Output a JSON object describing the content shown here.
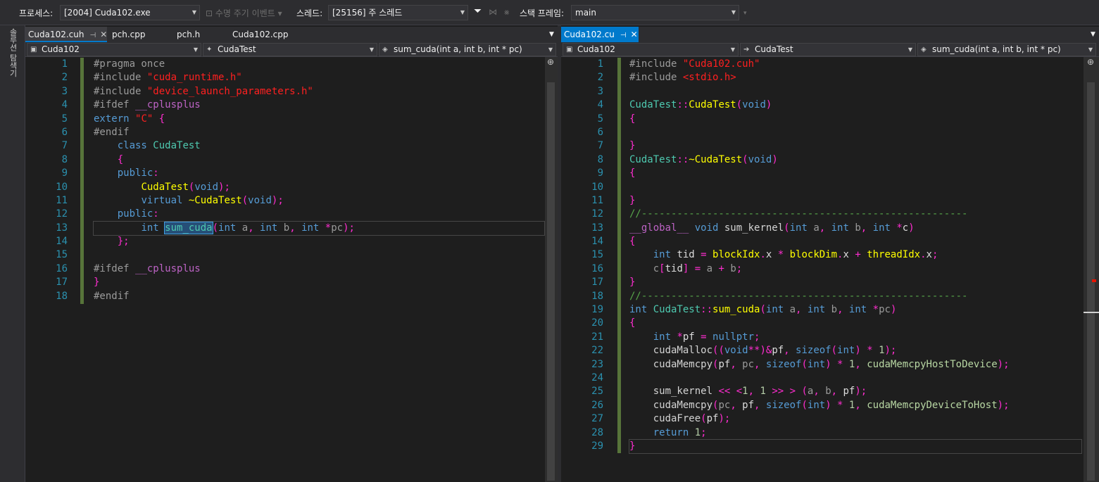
{
  "toolbar": {
    "process_label": "프로세스:",
    "process_value": "[2004] Cuda102.exe",
    "lifecycle_label": "수명 주기 이벤트",
    "thread_label": "스레드:",
    "thread_value": "[25156] 주 스레드",
    "stack_label": "스택 프레임:",
    "stack_value": "main"
  },
  "side_label": "솔루션 탐색기",
  "left": {
    "tabs": [
      {
        "label": "Cuda102.cuh",
        "active": true
      },
      {
        "label": "pch.cpp"
      },
      {
        "label": "pch.h"
      },
      {
        "label": "Cuda102.cpp"
      }
    ],
    "nav": {
      "project": "Cuda102",
      "class": "CudaTest",
      "member": "sum_cuda(int a, int b, int * pc)"
    },
    "line_numbers": [
      "1",
      "2",
      "3",
      "4",
      "5",
      "6",
      "7",
      "8",
      "9",
      "10",
      "11",
      "12",
      "13",
      "14",
      "15",
      "16",
      "17",
      "18"
    ]
  },
  "right": {
    "tabs": [
      {
        "label": "Cuda102.cu",
        "active": true
      }
    ],
    "nav": {
      "project": "Cuda102",
      "class": "CudaTest",
      "member": "sum_cuda(int a, int b, int * pc)"
    },
    "line_numbers": [
      "1",
      "2",
      "3",
      "4",
      "5",
      "6",
      "7",
      "8",
      "9",
      "10",
      "11",
      "12",
      "13",
      "14",
      "15",
      "16",
      "17",
      "18",
      "19",
      "20",
      "21",
      "22",
      "23",
      "24",
      "25",
      "26",
      "27",
      "28",
      "29"
    ]
  },
  "left_code": [
    [
      [
        "pp",
        "#pragma once"
      ]
    ],
    [
      [
        "pp",
        "#include "
      ],
      [
        "str",
        "\"cuda_runtime.h\""
      ]
    ],
    [
      [
        "pp",
        "#include "
      ],
      [
        "str",
        "\"device_launch_parameters.h\""
      ]
    ],
    [
      [
        "pp",
        "#ifdef "
      ],
      [
        "mac",
        "__cplusplus"
      ]
    ],
    [
      [
        "kw",
        "extern "
      ],
      [
        "str",
        "\"C\" "
      ],
      [
        "punc",
        "{"
      ]
    ],
    [
      [
        "pp",
        "#endif"
      ]
    ],
    [
      [
        "var",
        "    "
      ],
      [
        "kw",
        "class "
      ],
      [
        "cls",
        "CudaTest"
      ]
    ],
    [
      [
        "var",
        "    "
      ],
      [
        "punc",
        "{"
      ]
    ],
    [
      [
        "var",
        "    "
      ],
      [
        "kw",
        "public"
      ],
      [
        "punc",
        ":"
      ]
    ],
    [
      [
        "var",
        "        "
      ],
      [
        "glob",
        "CudaTest"
      ],
      [
        "punc",
        "("
      ],
      [
        "kw",
        "void"
      ],
      [
        "punc",
        ");"
      ]
    ],
    [
      [
        "var",
        "        "
      ],
      [
        "kw",
        "virtual "
      ],
      [
        "glob",
        "~CudaTest"
      ],
      [
        "punc",
        "("
      ],
      [
        "kw",
        "void"
      ],
      [
        "punc",
        ");"
      ]
    ],
    [
      [
        "var",
        "    "
      ],
      [
        "kw",
        "public"
      ],
      [
        "punc",
        ":"
      ]
    ],
    [
      [
        "var",
        "        "
      ],
      [
        "kw",
        "int "
      ],
      [
        "hlfn",
        "sum_cuda"
      ],
      [
        "punc",
        "("
      ],
      [
        "kw",
        "int "
      ],
      [
        "param",
        "a"
      ],
      [
        "punc",
        ", "
      ],
      [
        "kw",
        "int "
      ],
      [
        "param",
        "b"
      ],
      [
        "punc",
        ", "
      ],
      [
        "kw",
        "int "
      ],
      [
        "punc",
        "*"
      ],
      [
        "param",
        "pc"
      ],
      [
        "punc",
        ");"
      ]
    ],
    [
      [
        "var",
        "    "
      ],
      [
        "punc",
        "};"
      ]
    ],
    [
      [
        "var",
        ""
      ]
    ],
    [
      [
        "pp",
        "#ifdef "
      ],
      [
        "mac",
        "__cplusplus"
      ]
    ],
    [
      [
        "punc",
        "}"
      ]
    ],
    [
      [
        "pp",
        "#endif"
      ]
    ]
  ],
  "right_code": [
    [
      [
        "pp",
        "#include "
      ],
      [
        "str",
        "\"Cuda102.cuh\""
      ]
    ],
    [
      [
        "pp",
        "#include "
      ],
      [
        "str",
        "<stdio.h>"
      ]
    ],
    [
      [
        "var",
        ""
      ]
    ],
    [
      [
        "cls",
        "CudaTest"
      ],
      [
        "punc",
        "::"
      ],
      [
        "glob",
        "CudaTest"
      ],
      [
        "punc",
        "("
      ],
      [
        "kw",
        "void"
      ],
      [
        "punc",
        ")"
      ]
    ],
    [
      [
        "punc",
        "{"
      ]
    ],
    [
      [
        "var",
        ""
      ]
    ],
    [
      [
        "punc",
        "}"
      ]
    ],
    [
      [
        "cls",
        "CudaTest"
      ],
      [
        "punc",
        "::"
      ],
      [
        "glob",
        "~CudaTest"
      ],
      [
        "punc",
        "("
      ],
      [
        "kw",
        "void"
      ],
      [
        "punc",
        ")"
      ]
    ],
    [
      [
        "punc",
        "{"
      ]
    ],
    [
      [
        "var",
        ""
      ]
    ],
    [
      [
        "punc",
        "}"
      ]
    ],
    [
      [
        "cm",
        "//-------------------------------------------------------"
      ]
    ],
    [
      [
        "mac",
        "__global__ "
      ],
      [
        "kw",
        "void "
      ],
      [
        "fn",
        "sum_kernel"
      ],
      [
        "punc",
        "("
      ],
      [
        "kw",
        "int "
      ],
      [
        "param",
        "a"
      ],
      [
        "punc",
        ", "
      ],
      [
        "kw",
        "int "
      ],
      [
        "param",
        "b"
      ],
      [
        "punc",
        ", "
      ],
      [
        "kw",
        "int "
      ],
      [
        "punc",
        "*"
      ],
      [
        "var",
        "c"
      ],
      [
        "punc",
        ")"
      ]
    ],
    [
      [
        "punc",
        "{"
      ]
    ],
    [
      [
        "var",
        "    "
      ],
      [
        "kw",
        "int "
      ],
      [
        "var",
        "tid "
      ],
      [
        "punc",
        "= "
      ],
      [
        "glob",
        "blockIdx"
      ],
      [
        "punc",
        "."
      ],
      [
        "var",
        "x "
      ],
      [
        "punc",
        "* "
      ],
      [
        "glob",
        "blockDim"
      ],
      [
        "punc",
        "."
      ],
      [
        "var",
        "x "
      ],
      [
        "punc",
        "+ "
      ],
      [
        "glob",
        "threadIdx"
      ],
      [
        "punc",
        "."
      ],
      [
        "var",
        "x"
      ],
      [
        "punc",
        ";"
      ]
    ],
    [
      [
        "var",
        "    "
      ],
      [
        "param",
        "c"
      ],
      [
        "punc",
        "["
      ],
      [
        "var",
        "tid"
      ],
      [
        "punc",
        "] = "
      ],
      [
        "param",
        "a "
      ],
      [
        "punc",
        "+ "
      ],
      [
        "param",
        "b"
      ],
      [
        "punc",
        ";"
      ]
    ],
    [
      [
        "punc",
        "}"
      ]
    ],
    [
      [
        "cm",
        "//-------------------------------------------------------"
      ]
    ],
    [
      [
        "kw",
        "int "
      ],
      [
        "cls",
        "CudaTest"
      ],
      [
        "punc",
        "::"
      ],
      [
        "glob",
        "sum_cuda"
      ],
      [
        "punc",
        "("
      ],
      [
        "kw",
        "int "
      ],
      [
        "param",
        "a"
      ],
      [
        "punc",
        ", "
      ],
      [
        "kw",
        "int "
      ],
      [
        "param",
        "b"
      ],
      [
        "punc",
        ", "
      ],
      [
        "kw",
        "int "
      ],
      [
        "punc",
        "*"
      ],
      [
        "param",
        "pc"
      ],
      [
        "punc",
        ")"
      ]
    ],
    [
      [
        "punc",
        "{"
      ]
    ],
    [
      [
        "var",
        "    "
      ],
      [
        "kw",
        "int "
      ],
      [
        "punc",
        "*"
      ],
      [
        "var",
        "pf "
      ],
      [
        "punc",
        "= "
      ],
      [
        "kw",
        "nullptr"
      ],
      [
        "punc",
        ";"
      ]
    ],
    [
      [
        "var",
        "    "
      ],
      [
        "fn",
        "cudaMalloc"
      ],
      [
        "punc",
        "(("
      ],
      [
        "kw",
        "void"
      ],
      [
        "punc",
        "**)&"
      ],
      [
        "var",
        "pf"
      ],
      [
        "punc",
        ", "
      ],
      [
        "kw",
        "sizeof"
      ],
      [
        "punc",
        "("
      ],
      [
        "kw",
        "int"
      ],
      [
        "punc",
        ") * "
      ],
      [
        "num",
        "1"
      ],
      [
        "punc",
        ");"
      ]
    ],
    [
      [
        "var",
        "    "
      ],
      [
        "fn",
        "cudaMemcpy"
      ],
      [
        "punc",
        "("
      ],
      [
        "var",
        "pf"
      ],
      [
        "punc",
        ", "
      ],
      [
        "param",
        "pc"
      ],
      [
        "punc",
        ", "
      ],
      [
        "kw",
        "sizeof"
      ],
      [
        "punc",
        "("
      ],
      [
        "kw",
        "int"
      ],
      [
        "punc",
        ") * "
      ],
      [
        "num",
        "1"
      ],
      [
        "punc",
        ", "
      ],
      [
        "en",
        "cudaMemcpyHostToDevice"
      ],
      [
        "punc",
        ");"
      ]
    ],
    [
      [
        "var",
        ""
      ]
    ],
    [
      [
        "var",
        "    "
      ],
      [
        "fn",
        "sum_kernel "
      ],
      [
        "punc",
        "<< <"
      ],
      [
        "num",
        "1"
      ],
      [
        "punc",
        ", "
      ],
      [
        "num",
        "1 "
      ],
      [
        "punc",
        ">> > ("
      ],
      [
        "param",
        "a"
      ],
      [
        "punc",
        ", "
      ],
      [
        "param",
        "b"
      ],
      [
        "punc",
        ", "
      ],
      [
        "var",
        "pf"
      ],
      [
        "punc",
        ");"
      ]
    ],
    [
      [
        "var",
        "    "
      ],
      [
        "fn",
        "cudaMemcpy"
      ],
      [
        "punc",
        "("
      ],
      [
        "param",
        "pc"
      ],
      [
        "punc",
        ", "
      ],
      [
        "var",
        "pf"
      ],
      [
        "punc",
        ", "
      ],
      [
        "kw",
        "sizeof"
      ],
      [
        "punc",
        "("
      ],
      [
        "kw",
        "int"
      ],
      [
        "punc",
        ") * "
      ],
      [
        "num",
        "1"
      ],
      [
        "punc",
        ", "
      ],
      [
        "en",
        "cudaMemcpyDeviceToHost"
      ],
      [
        "punc",
        ");"
      ]
    ],
    [
      [
        "var",
        "    "
      ],
      [
        "fn",
        "cudaFree"
      ],
      [
        "punc",
        "("
      ],
      [
        "var",
        "pf"
      ],
      [
        "punc",
        ");"
      ]
    ],
    [
      [
        "var",
        "    "
      ],
      [
        "kw",
        "return "
      ],
      [
        "num",
        "1"
      ],
      [
        "punc",
        ";"
      ]
    ],
    [
      [
        "punc",
        "}"
      ]
    ]
  ]
}
